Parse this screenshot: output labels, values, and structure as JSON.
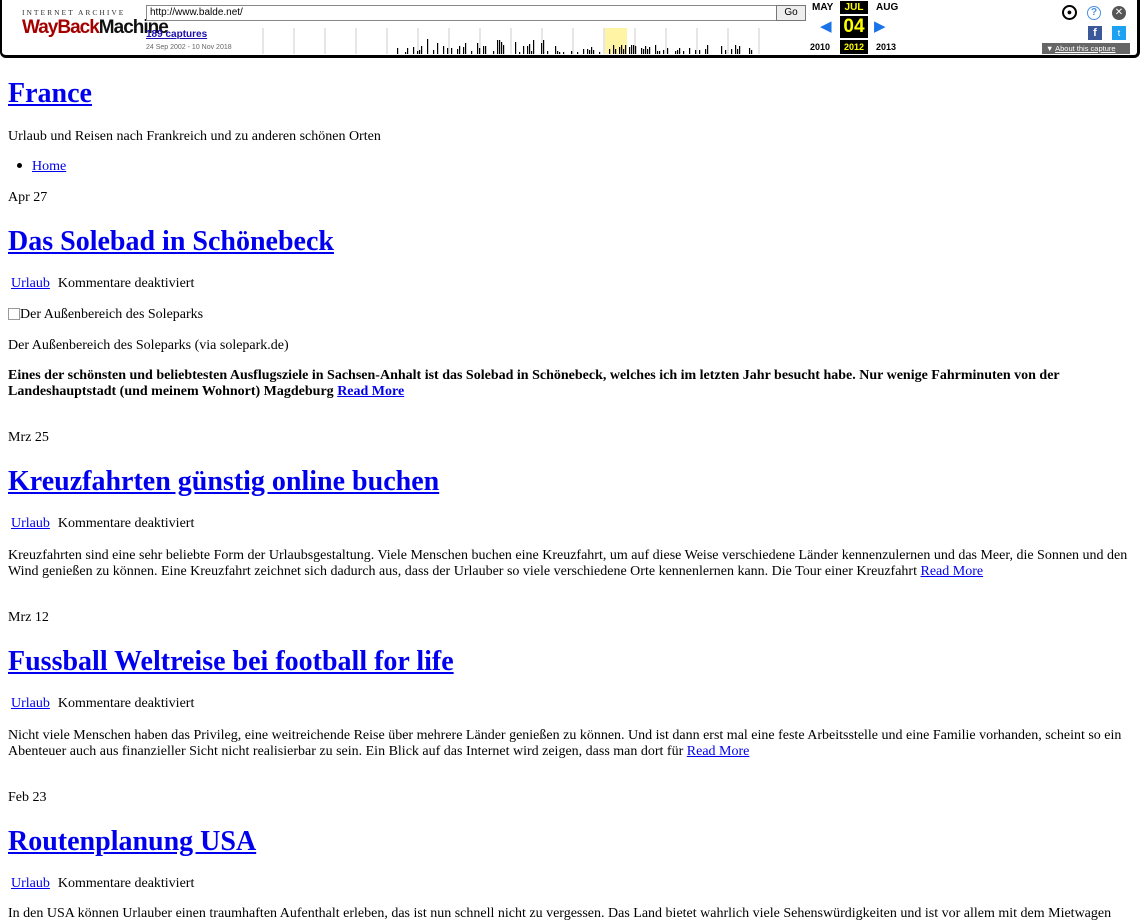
{
  "wayback": {
    "logo_top": "INTERNET ARCHIVE",
    "logo_wayback": "WayBack",
    "logo_machine": "Machine",
    "url": "http://www.balde.net/",
    "go_label": "Go",
    "captures_link": "189 captures",
    "capture_range": "24 Sep 2002 - 10 Nov 2018",
    "month_prev": "MAY",
    "month_cur": "JUL",
    "month_next": "AUG",
    "day": "04",
    "year_prev": "2010",
    "year_cur": "2012",
    "year_next": "2013",
    "about_label": "About this capture",
    "arrow_prev": "◀",
    "arrow_next": "▶",
    "icons": [
      "user-icon",
      "help-icon",
      "close-icon",
      "facebook-icon",
      "twitter-icon"
    ]
  },
  "site": {
    "title": "France",
    "description": "Urlaub und Reisen nach Frankreich und zu anderen schönen Orten",
    "menu": [
      "Home"
    ]
  },
  "posts": [
    {
      "date": "Apr 27",
      "title": "Das Solebad in Schönebeck",
      "category": "Urlaub",
      "comments": "Kommentare deaktiviert",
      "image_alt": "Der Außenbereich des Soleparks",
      "caption": "Der Außenbereich des Soleparks (via solepark.de)",
      "excerpt": "Eines der schönsten und beliebtesten Ausflugsziele in Sachsen-Anhalt ist das Solebad in Schönebeck, welches ich im letzten Jahr besucht habe. Nur wenige Fahrminuten von der Landeshauptstadt (und meinem Wohnort) Magdeburg",
      "read_more": "Read More"
    },
    {
      "date": "Mrz 25",
      "title": "Kreuzfahrten günstig online buchen",
      "category": "Urlaub",
      "comments": "Kommentare deaktiviert",
      "excerpt": "Kreuzfahrten sind eine sehr beliebte Form der Urlaubsgestaltung. Viele Menschen buchen eine Kreuzfahrt, um auf diese Weise verschiedene Länder kennenzulernen und das Meer, die Sonnen und den Wind genießen zu können. Eine Kreuzfahrt zeichnet sich dadurch aus, dass der Urlauber so viele verschiedene Orte kennenlernen kann. Die Tour einer Kreuzfahrt",
      "read_more": "Read More"
    },
    {
      "date": "Mrz 12",
      "title": "Fussball Weltreise bei football for life",
      "category": "Urlaub",
      "comments": "Kommentare deaktiviert",
      "excerpt": "Nicht viele Menschen haben das Privileg, eine weitreichende Reise über mehrere Länder genießen zu können. Und ist dann erst mal eine feste Arbeitsstelle und eine Familie vorhanden, scheint so ein Abenteuer auch aus finanzieller Sicht nicht realisierbar zu sein. Ein Blick auf das Internet wird zeigen, dass man dort für",
      "read_more": "Read More"
    },
    {
      "date": "Feb 23",
      "title": "Routenplanung USA",
      "category": "Urlaub",
      "comments": "Kommentare deaktiviert",
      "excerpt": "In den USA können Urlauber einen traumhaften Aufenthalt erleben, das ist nun schnell nicht zu vergessen. Das Land bietet wahrlich viele Sehenswürdigkeiten und ist vor allem mit dem Mietwagen"
    }
  ]
}
